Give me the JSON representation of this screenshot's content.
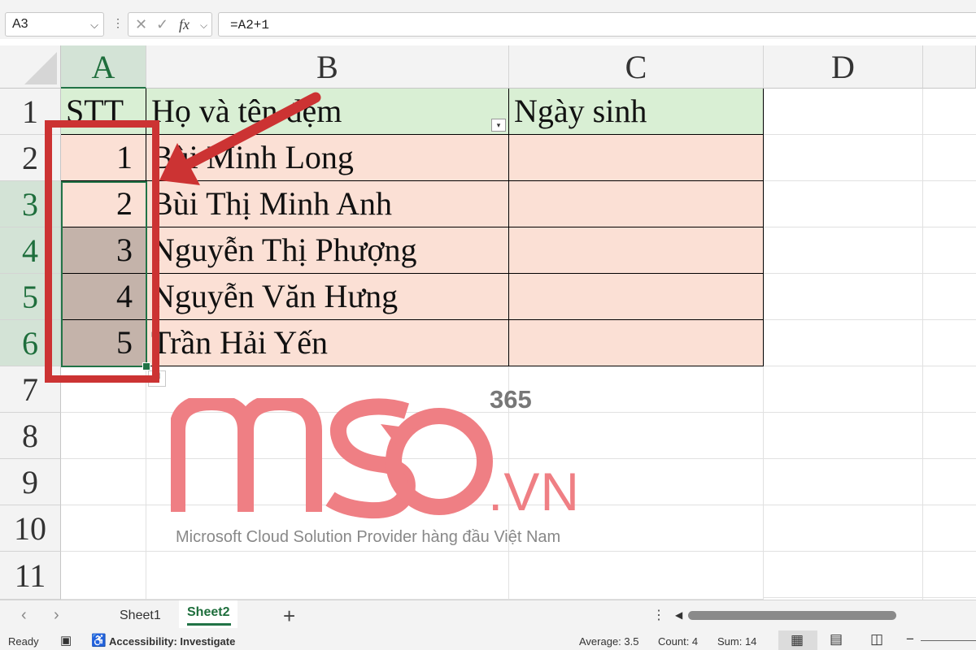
{
  "formula_bar": {
    "name_box": "A3",
    "cancel_symbol": "✕",
    "enter_symbol": "✓",
    "function_symbol": "fx",
    "formula": "=A2+1"
  },
  "columns": [
    "A",
    "B",
    "C",
    "D"
  ],
  "rows": [
    "1",
    "2",
    "3",
    "4",
    "5",
    "6",
    "7",
    "8",
    "9",
    "10",
    "11"
  ],
  "table": {
    "headers": [
      "STT",
      "Họ và tên đệm",
      "Ngày sinh"
    ],
    "rows": [
      {
        "stt": "1",
        "name": "Bùi Minh Long",
        "dob": ""
      },
      {
        "stt": "2",
        "name": "Bùi Thị Minh Anh",
        "dob": ""
      },
      {
        "stt": "3",
        "name": "Nguyễn Thị Phượng",
        "dob": ""
      },
      {
        "stt": "4",
        "name": "Nguyễn Văn Hưng",
        "dob": ""
      },
      {
        "stt": "5",
        "name": "Trần Hải Yến",
        "dob": ""
      }
    ]
  },
  "watermark": {
    "logo_text": "MSO",
    "superscript": "365",
    "suffix": ".VN",
    "tagline": "Microsoft Cloud Solution Provider hàng đầu Việt Nam"
  },
  "sheet_tabs": {
    "tabs": [
      "Sheet1",
      "Sheet2"
    ],
    "active": "Sheet2",
    "add_symbol": "+"
  },
  "status_bar": {
    "ready": "Ready",
    "accessibility": "Accessibility: Investigate",
    "average": "Average: 3.5",
    "count": "Count: 4",
    "sum": "Sum: 14"
  },
  "colors": {
    "selection_green": "#217346",
    "header_fill": "#d9efd4",
    "row_fill": "#fbe0d5",
    "selected_fill": "#c4b3aa",
    "annotation_red": "#cc3333",
    "watermark_pink": "#ef7f84"
  },
  "icons": [
    "chevron-down-icon",
    "cancel-icon",
    "enter-icon",
    "function-icon",
    "filter-dropdown-icon",
    "annotation-arrow",
    "autofill-options-icon",
    "camera-icon",
    "accessibility-icon",
    "normal-view-icon",
    "page-layout-icon",
    "page-break-icon"
  ]
}
